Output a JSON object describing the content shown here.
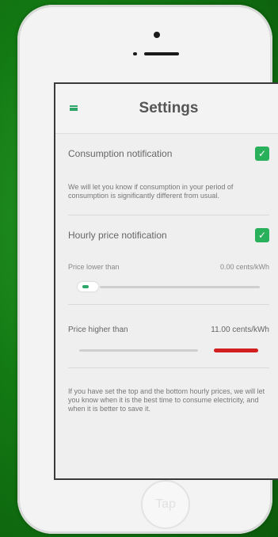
{
  "app": {
    "title": "Settings"
  },
  "settings": {
    "consumption": {
      "label": "Consumption notification",
      "checked": true,
      "description": "We will let you know if consumption in your period of consumption is significantly different from usual."
    },
    "hourly": {
      "label": "Hourly price notification",
      "checked": true,
      "range_label": "Price lower than",
      "range_value": "0.00 cents/kWh",
      "range_level": 0.08,
      "price_label": "Price higher than",
      "price_value": "11.00 cents/kWh",
      "price_level": 0.75,
      "description": "If you have set the top and the bottom hourly prices, we will let you know when it is the best time to consume electricity, and when it is better to save it."
    }
  },
  "device": {
    "home_label": "Tap"
  },
  "colors": {
    "accent": "#28b05a",
    "alert": "#d21f1f"
  }
}
